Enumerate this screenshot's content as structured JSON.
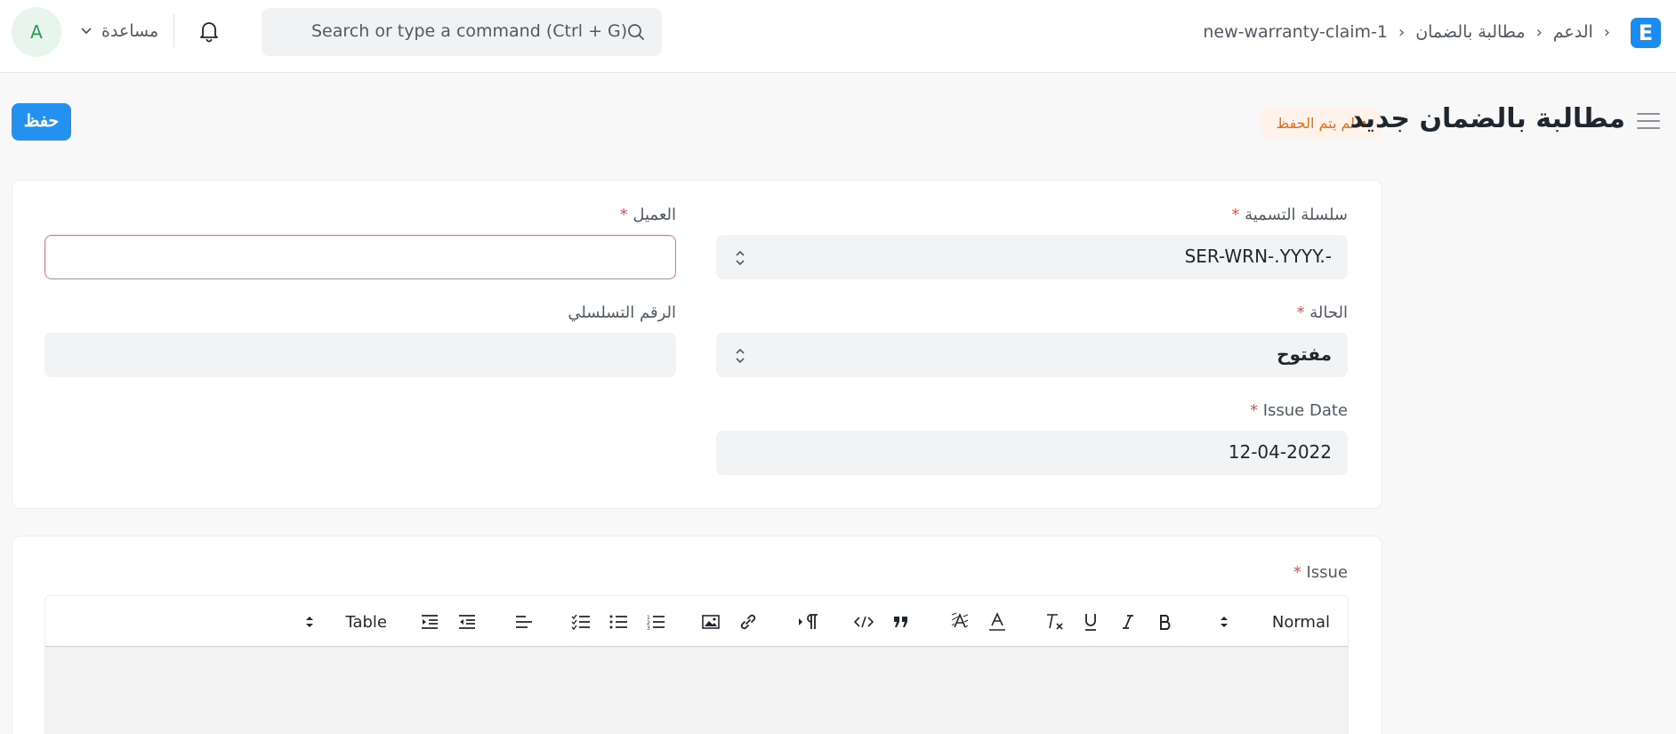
{
  "navbar": {
    "logo_letter": "E",
    "breadcrumbs": [
      "الدعم",
      "مطالبة بالضمان",
      "new-warranty-claim-1"
    ],
    "search_placeholder": "Search or type a command (Ctrl + G)",
    "help_label": "مساعدة",
    "avatar_initial": "A"
  },
  "page": {
    "title": "مطالبة بالضمان جديد",
    "status_badge": "لم يتم الحفظ",
    "save_label": "حفظ"
  },
  "form": {
    "naming_series": {
      "label": "سلسلة التسمية",
      "value": "SER-WRN-.YYYY.-",
      "required": true
    },
    "customer": {
      "label": "العميل",
      "value": "",
      "required": true
    },
    "status": {
      "label": "الحالة",
      "value": "مفتوح",
      "required": true
    },
    "serial_no": {
      "label": "الرقم التسلسلي",
      "value": ""
    },
    "issue_date": {
      "label": "Issue Date",
      "value": "12-04-2022",
      "required": true
    },
    "issue": {
      "label": "Issue",
      "required": true
    }
  },
  "editor_toolbar": {
    "header_select": "Normal",
    "table_label": "Table",
    "icons": [
      "bold-icon",
      "italic-icon",
      "underline-icon",
      "clear-format-icon",
      "text-color-icon",
      "background-color-icon",
      "blockquote-icon",
      "code-block-icon",
      "text-direction-icon",
      "link-icon",
      "image-icon",
      "ordered-list-icon",
      "bullet-list-icon",
      "check-list-icon",
      "align-icon",
      "outdent-icon",
      "indent-icon"
    ]
  },
  "colors": {
    "accent": "#2490ef",
    "status": "#e86c13",
    "required": "#e24c4c",
    "avatar_bg": "#e7f5ec"
  }
}
